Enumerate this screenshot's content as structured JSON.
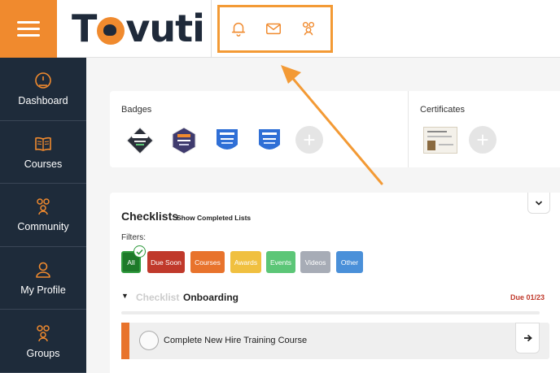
{
  "brand": {
    "logo_text_before": "T",
    "logo_text_after": "vuti",
    "accent": "#f08a2e",
    "dark": "#1e2b3a"
  },
  "header": {
    "icons": [
      "bell-icon",
      "envelope-icon",
      "community-icon"
    ]
  },
  "sidebar": {
    "items": [
      {
        "label": "Dashboard",
        "icon": "gauge-icon"
      },
      {
        "label": "Courses",
        "icon": "book-icon"
      },
      {
        "label": "Community",
        "icon": "people-icon"
      },
      {
        "label": "My Profile",
        "icon": "person-icon"
      },
      {
        "label": "Groups",
        "icon": "group-icon"
      }
    ]
  },
  "badges": {
    "title": "Badges",
    "items": [
      "GetApp",
      "Software Advice",
      "Capterra",
      "Capterra"
    ]
  },
  "certificates": {
    "title": "Certificates"
  },
  "checklists": {
    "title": "Checklists",
    "show_completed": "Show Completed Lists",
    "filters_label": "Filters:",
    "filters": [
      {
        "label": "All",
        "color": "#1e7a2a"
      },
      {
        "label": "Due Soon",
        "color": "#c0392b"
      },
      {
        "label": "Courses",
        "color": "#e8732c"
      },
      {
        "label": "Awards",
        "color": "#f0c040"
      },
      {
        "label": "Events",
        "color": "#5cc677"
      },
      {
        "label": "Videos",
        "color": "#a7acb6"
      },
      {
        "label": "Other",
        "color": "#4a90d9"
      }
    ],
    "section": {
      "word": "Checklist",
      "name": "Onboarding",
      "due": "Due 01/23"
    },
    "task": {
      "label": "Complete New Hire Training Course"
    }
  },
  "annotation": {
    "color": "#f39a35"
  }
}
